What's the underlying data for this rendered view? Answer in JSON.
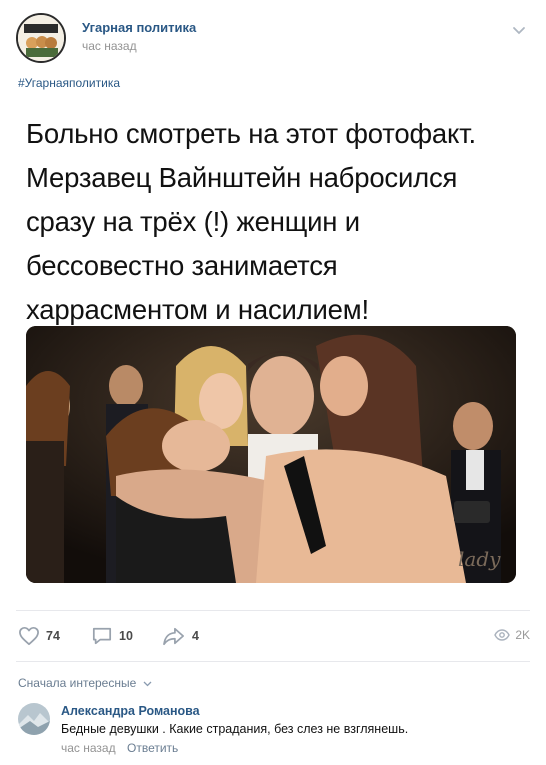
{
  "post": {
    "author": "Угарная политика",
    "time": "час назад",
    "avatar_text": "УГАРНАЯ ПОЛИТИКА",
    "hashtag": "#Угарнаяполитика",
    "text_lines": [
      "Больно смотреть на этот фотофакт.",
      "Мерзавец Вайнштейн набросился",
      "сразу на трёх (!) женщин и",
      "бессовестно занимается",
      "харрасментом и насилием!"
    ],
    "photo_watermark": "lady"
  },
  "actions": {
    "likes": "74",
    "comments": "10",
    "shares": "4",
    "views": "2K"
  },
  "comments": {
    "sort_label": "Сначала интересные",
    "items": [
      {
        "author": "Александра Романова",
        "text": "Бедные девушки . Какие страдания, без слез не взглянешь.",
        "time": "час назад",
        "reply_label": "Ответить"
      }
    ]
  },
  "colors": {
    "link": "#2a5885",
    "muted": "#939393",
    "icon": "#99a2ad"
  }
}
